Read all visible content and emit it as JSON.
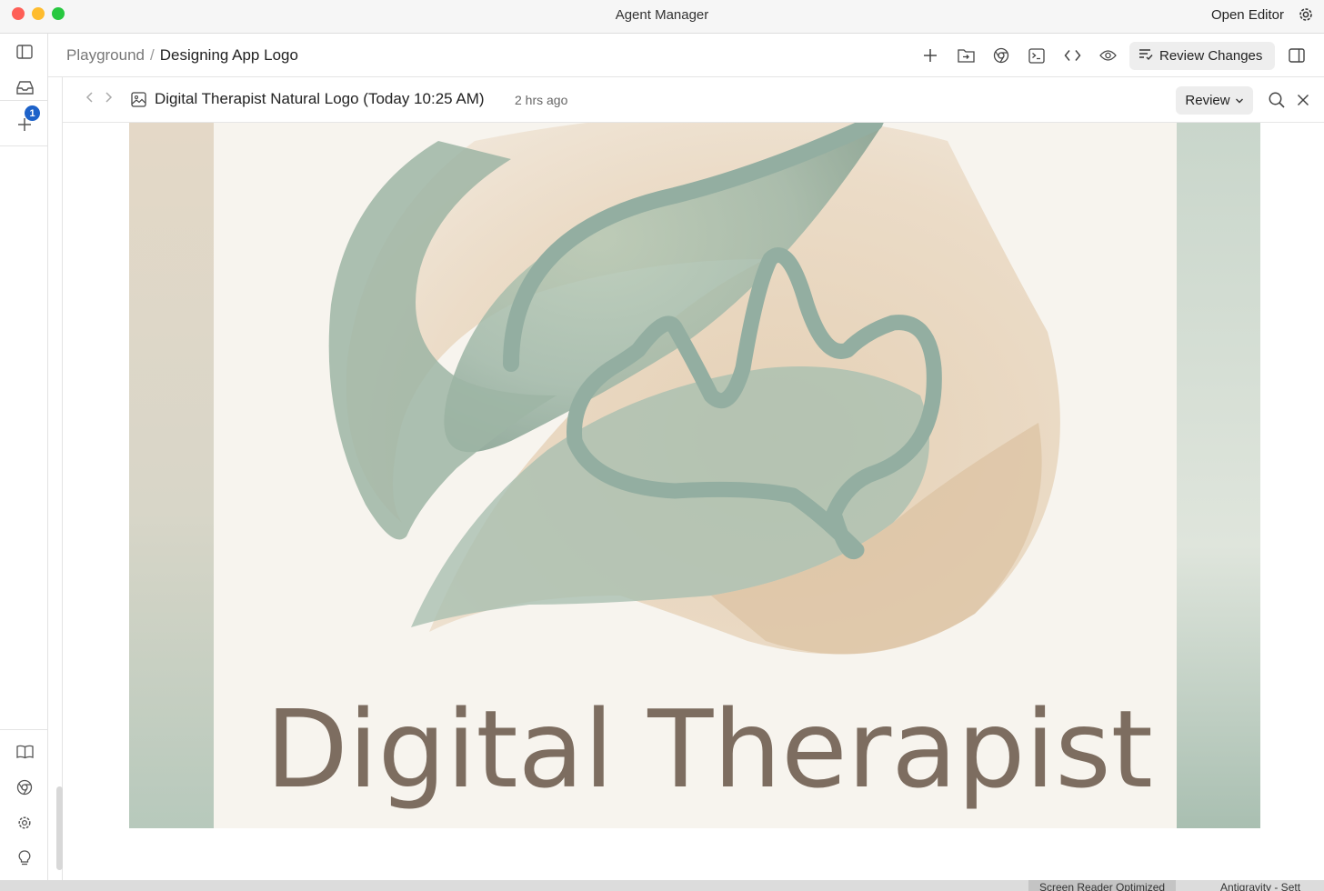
{
  "window": {
    "title": "Agent Manager",
    "open_editor": "Open Editor"
  },
  "traffic_lights": {
    "close": "#fe5f57",
    "minimize": "#febc2e",
    "zoom": "#28c840"
  },
  "sidebar": {
    "inbox_badge": "1"
  },
  "breadcrumb": {
    "parent": "Playground",
    "separator": "/",
    "current": "Designing App Logo"
  },
  "toolbar": {
    "review_changes_label": "Review Changes"
  },
  "artifact": {
    "title": "Digital Therapist Natural Logo (Today 10:25 AM)",
    "time_ago": "2 hrs ago",
    "review_label": "Review"
  },
  "logo": {
    "text": "Digital Therapist",
    "text_color": "#7d6d60",
    "green": "#8fab9b",
    "sand": "#e3cfb6",
    "line": "#93aea1"
  },
  "status": {
    "item1": "Screen Reader Optimized",
    "item2": "Antigravity - Sett"
  }
}
